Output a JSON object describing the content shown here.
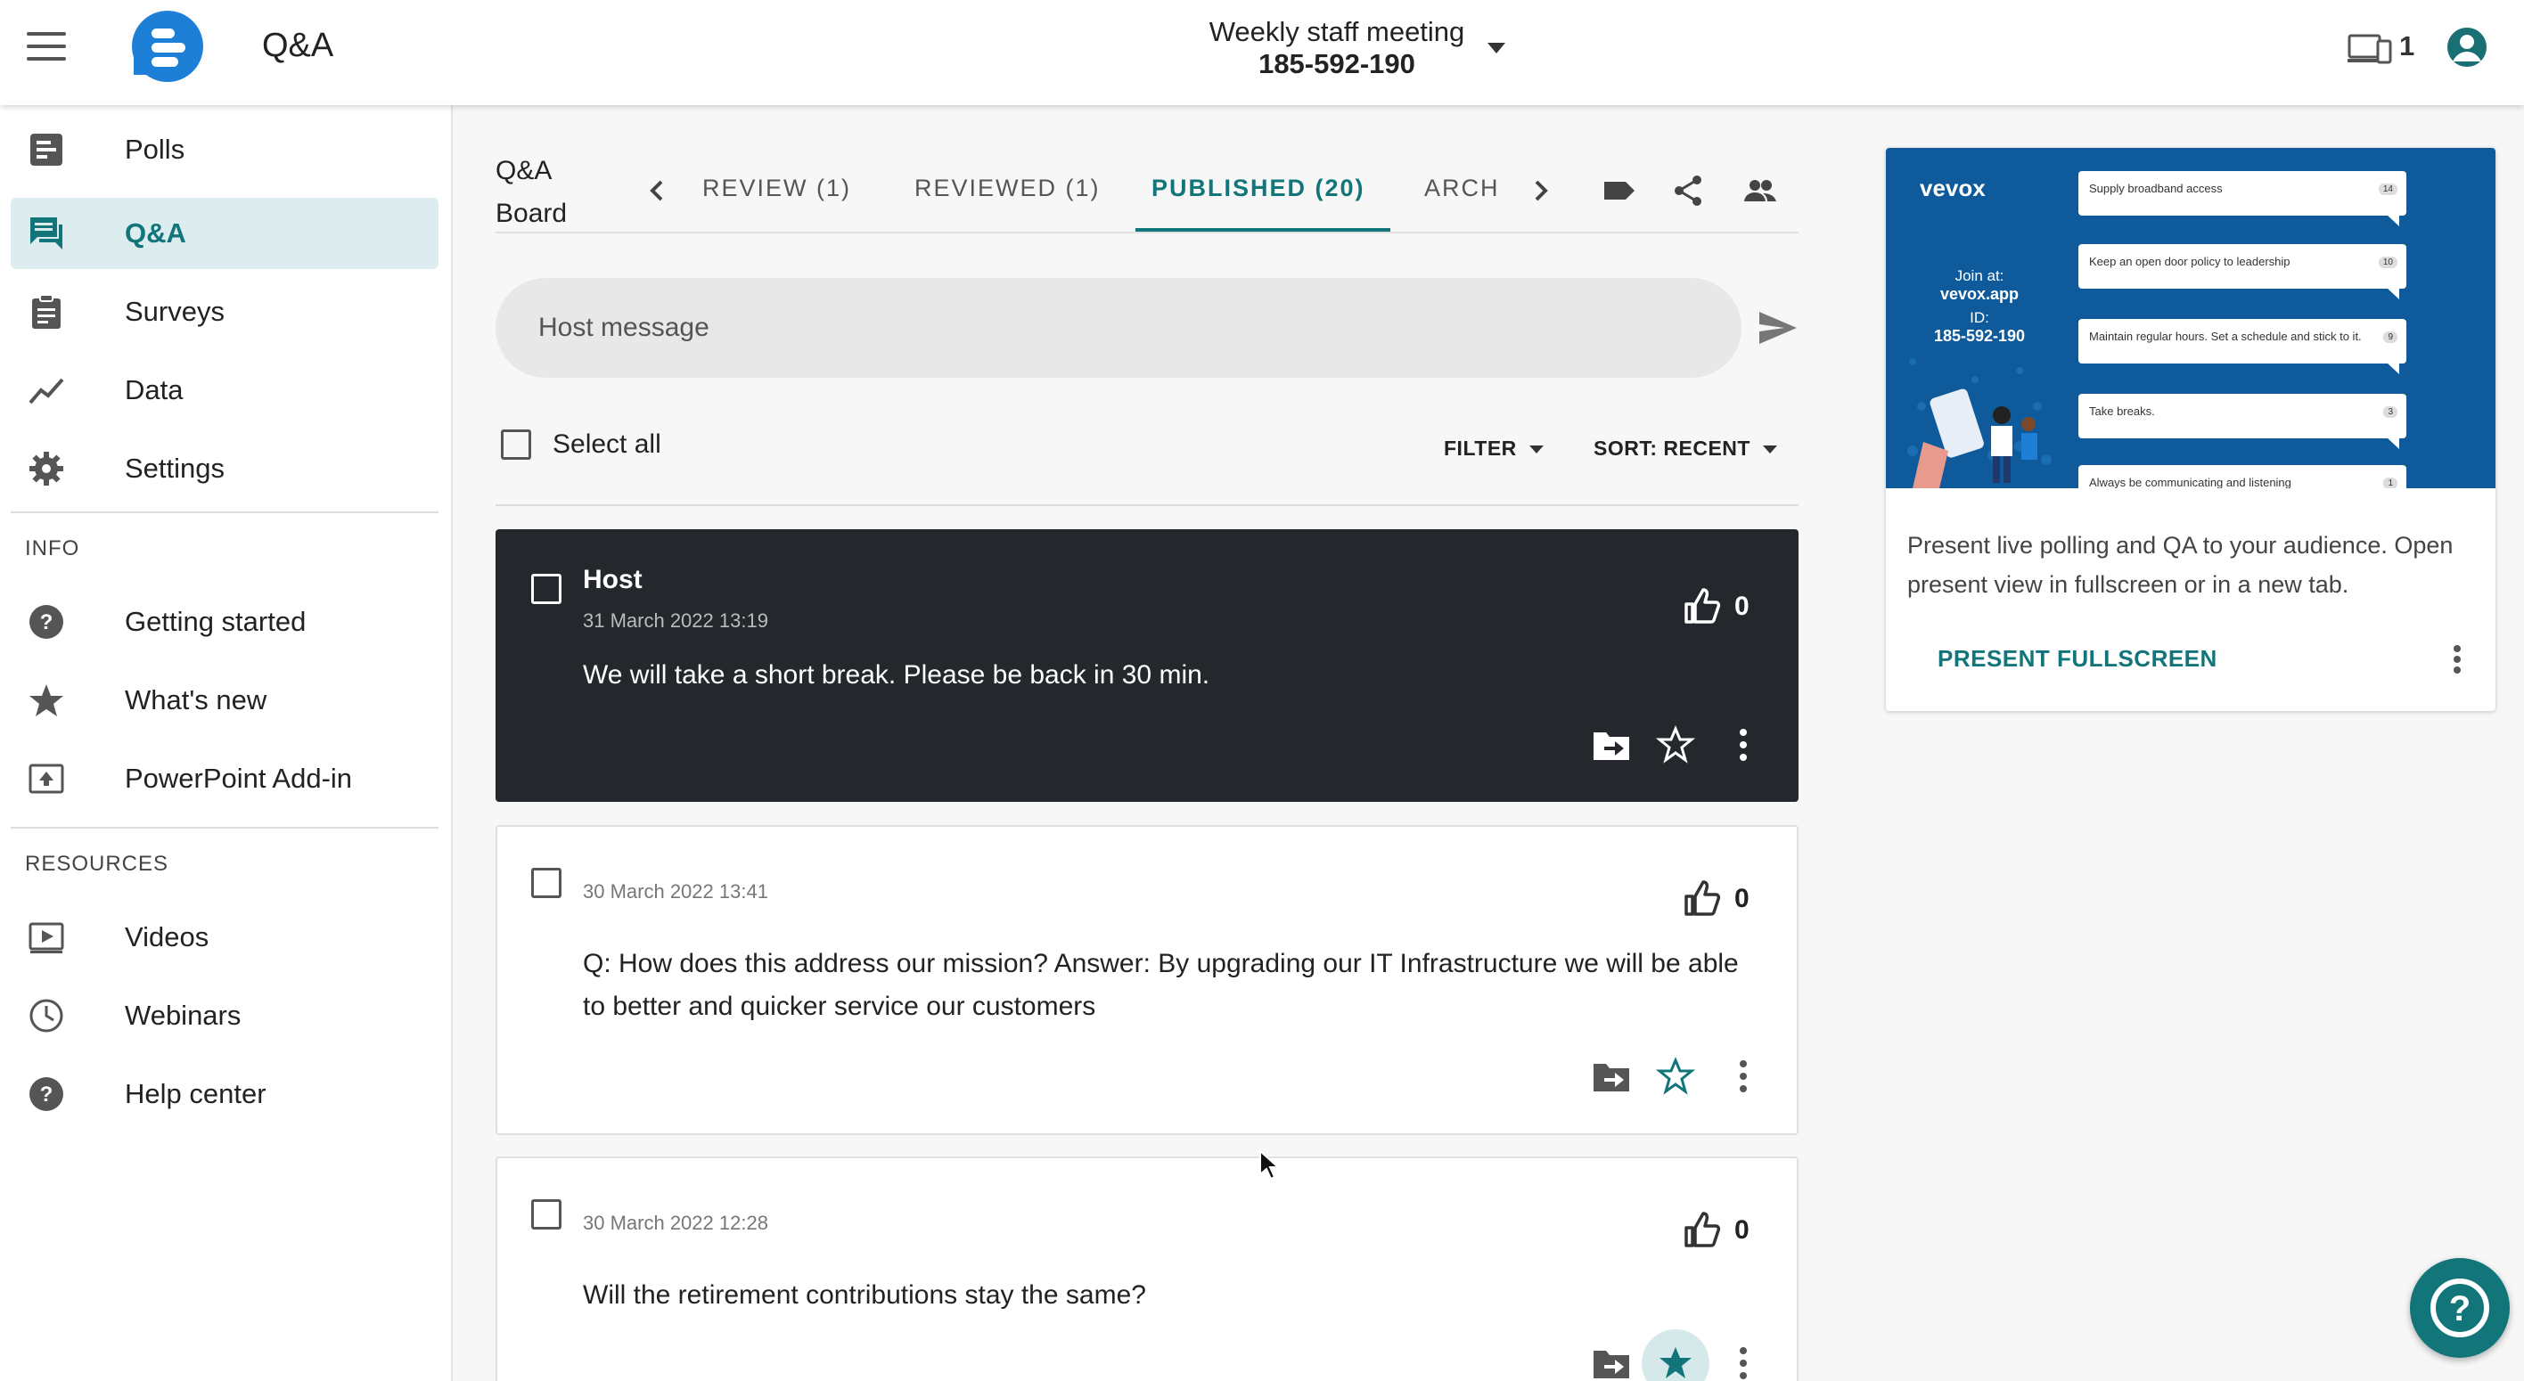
{
  "app": {
    "title": "Q&A"
  },
  "meeting": {
    "name": "Weekly staff meeting",
    "id": "185-592-190"
  },
  "devices": {
    "count": "1"
  },
  "sidebar": {
    "items": [
      {
        "label": "Polls",
        "icon": "polls-icon"
      },
      {
        "label": "Q&A",
        "icon": "qa-icon",
        "active": true
      },
      {
        "label": "Surveys",
        "icon": "surveys-icon"
      },
      {
        "label": "Data",
        "icon": "data-icon"
      },
      {
        "label": "Settings",
        "icon": "gear-icon"
      }
    ],
    "info_title": "INFO",
    "info_items": [
      {
        "label": "Getting started",
        "icon": "help-circle-icon"
      },
      {
        "label": "What's new",
        "icon": "star-icon"
      },
      {
        "label": "PowerPoint Add-in",
        "icon": "powerpoint-icon"
      }
    ],
    "resources_title": "RESOURCES",
    "resources_items": [
      {
        "label": "Videos",
        "icon": "video-icon"
      },
      {
        "label": "Webinars",
        "icon": "clock-icon"
      },
      {
        "label": "Help center",
        "icon": "help-circle-icon"
      }
    ]
  },
  "board": {
    "title_line1": "Q&A",
    "title_line2": "Board",
    "tabs": [
      {
        "label": "REVIEW (1)"
      },
      {
        "label": "REVIEWED (1)"
      },
      {
        "label": "PUBLISHED (20)",
        "active": true
      },
      {
        "label": "ARCH"
      }
    ],
    "host_message_placeholder": "Host message",
    "select_all_label": "Select all",
    "filter_label": "FILTER",
    "sort_label": "SORT: RECENT"
  },
  "messages": [
    {
      "author": "Host",
      "date": "31 March 2022 13:19",
      "text": "We will take a short break. Please be back in 30 min.",
      "likes": "0",
      "highlighted": true,
      "starred": false
    },
    {
      "author": "",
      "date": "30 March 2022 13:41",
      "text": "Q: How does this address our mission? Answer: By upgrading our IT Infrastructure we will be able to better and quicker service our customers",
      "likes": "0",
      "starred": false
    },
    {
      "author": "",
      "date": "30 March 2022 12:28",
      "text": "Will the retirement contributions stay the same?",
      "likes": "0",
      "starred": true
    }
  ],
  "present": {
    "preview": {
      "logo": "vevox",
      "join_label": "Join at:",
      "join_url": "vevox.app",
      "id_label": "ID:",
      "id_value": "185-592-190",
      "questions": [
        {
          "text": "Supply broadband access",
          "votes": "14"
        },
        {
          "text": "Keep an open door policy to leadership",
          "votes": "10"
        },
        {
          "text": "Maintain regular hours. Set a schedule and stick to it.",
          "votes": "9"
        },
        {
          "text": "Take breaks.",
          "votes": "3"
        },
        {
          "text": "Always be communicating and listening",
          "votes": "1"
        }
      ]
    },
    "description": "Present live polling and QA to your audience. Open present view in fullscreen or in a new tab.",
    "button_label": "PRESENT FULLSCREEN"
  },
  "colors": {
    "accent": "#11757a",
    "brand_blue": "#1e7fd6",
    "host_card": "#24282c"
  }
}
